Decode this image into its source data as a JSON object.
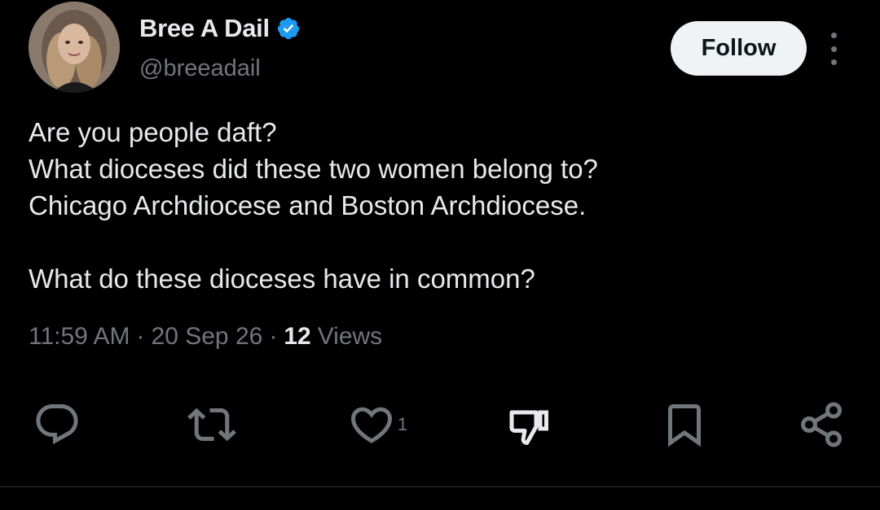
{
  "author": {
    "display_name": "Bree A Dail",
    "handle": "@breeadail",
    "verified": true
  },
  "follow_label": "Follow",
  "tweet": {
    "lines": [
      "Are you people daft?",
      "What dioceses did these two women belong to?",
      "Chicago Archdiocese and Boston Archdiocese.",
      "What do these dioceses have in common?"
    ]
  },
  "meta": {
    "time": "11:59 AM",
    "separator": "·",
    "date": "20 Sep 26",
    "views_count": "12",
    "views_label": "Views"
  },
  "actions": {
    "reply_icon": "reply-icon",
    "retweet_icon": "retweet-icon",
    "like_icon": "like-icon",
    "like_count": "1",
    "dislike_icon": "thumbs-down-icon",
    "bookmark_icon": "bookmark-icon",
    "share_icon": "share-icon"
  },
  "colors": {
    "background": "#000000",
    "text_primary": "#e7e9ea",
    "text_secondary": "#71767b",
    "verified": "#1d9bf0",
    "follow_bg": "#eff3f4",
    "divider": "#2f3336"
  }
}
